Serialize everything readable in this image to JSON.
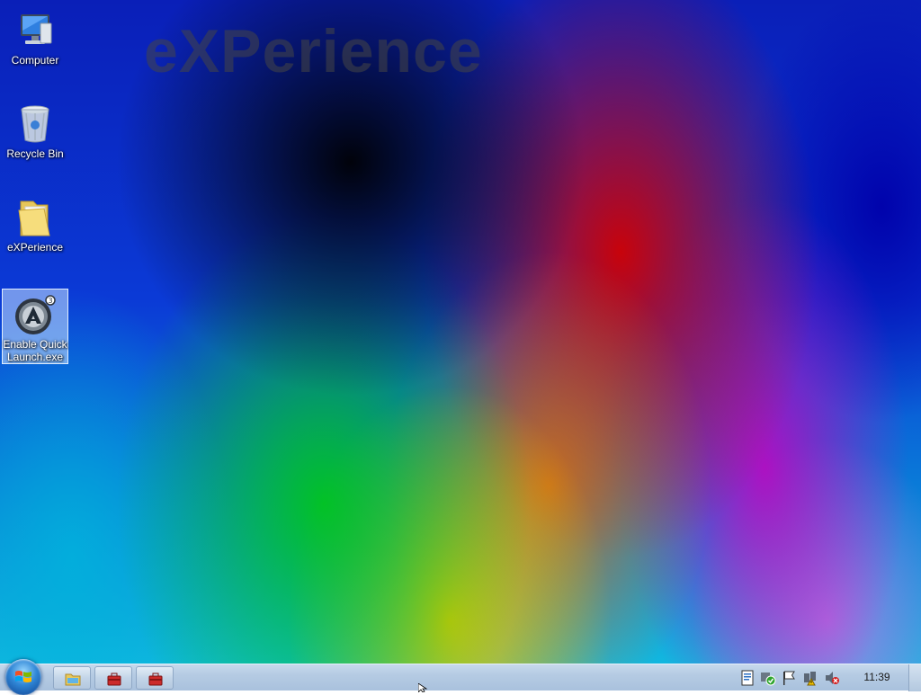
{
  "desktop": {
    "watermark": "eXPerience",
    "icons": [
      {
        "label": "Computer",
        "icon": "computer-icon"
      },
      {
        "label": "Recycle Bin",
        "icon": "recycle-bin-icon"
      },
      {
        "label": "eXPerience",
        "icon": "folder-icon"
      },
      {
        "label": "Enable Quick Launch.exe",
        "icon": "autoit-exe-icon",
        "selected": true
      }
    ]
  },
  "taskbar": {
    "start": {
      "icon": "windows-orb-icon"
    },
    "buttons": [
      {
        "icon": "folder-explorer-icon"
      },
      {
        "icon": "toolbox-icon"
      },
      {
        "icon": "toolbox-icon"
      }
    ],
    "tray_icons": [
      "document-icon",
      "security-shield-icon",
      "action-center-flag-icon",
      "network-warning-icon",
      "volume-muted-icon"
    ],
    "clock": "11:39"
  }
}
